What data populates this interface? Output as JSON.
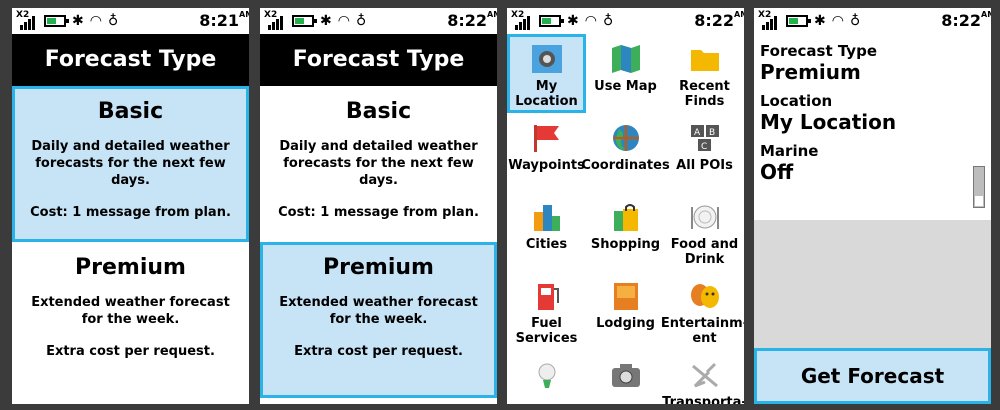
{
  "status": {
    "signal_label": "X2",
    "screens": [
      {
        "time": "8:21",
        "ampm": "AM"
      },
      {
        "time": "8:22",
        "ampm": "AM"
      },
      {
        "time": "8:22",
        "ampm": "AM"
      },
      {
        "time": "8:22",
        "ampm": "AM"
      }
    ]
  },
  "forecast_type": {
    "title": "Forecast Type",
    "options": [
      {
        "title": "Basic",
        "desc": "Daily and detailed weather forecasts for the next few days.",
        "cost": "Cost: 1 message from plan."
      },
      {
        "title": "Premium",
        "desc": "Extended weather forecast for the week.",
        "cost": "Extra cost per request."
      }
    ]
  },
  "location_menu": {
    "items": [
      {
        "label": "My Location",
        "icon": "my-location-icon"
      },
      {
        "label": "Use Map",
        "icon": "map-icon"
      },
      {
        "label": "Recent Finds",
        "icon": "folder-icon"
      },
      {
        "label": "Waypoints",
        "icon": "flag-icon"
      },
      {
        "label": "Coordinates",
        "icon": "globe-icon"
      },
      {
        "label": "All POIs",
        "icon": "abc-icon"
      },
      {
        "label": "Cities",
        "icon": "city-icon"
      },
      {
        "label": "Shopping",
        "icon": "shopping-bag-icon"
      },
      {
        "label": "Food and Drink",
        "icon": "plate-icon"
      },
      {
        "label": "Fuel Services",
        "icon": "fuel-pump-icon"
      },
      {
        "label": "Lodging",
        "icon": "bed-icon"
      },
      {
        "label": "Entertainm-ent",
        "icon": "masks-icon"
      },
      {
        "label": "",
        "icon": "golf-icon"
      },
      {
        "label": "",
        "icon": "camera-icon"
      },
      {
        "label": "Transporta-",
        "icon": "airplane-icon"
      }
    ]
  },
  "forecast_form": {
    "forecast_type_label": "Forecast Type",
    "forecast_type_value": "Premium",
    "location_label": "Location",
    "location_value": "My Location",
    "marine_label": "Marine",
    "marine_value": "Off",
    "button": "Get Forecast"
  },
  "colors": {
    "selection_fill": "#c6e4f6",
    "selection_border": "#2ab3e8",
    "battery": "#23b14d"
  }
}
